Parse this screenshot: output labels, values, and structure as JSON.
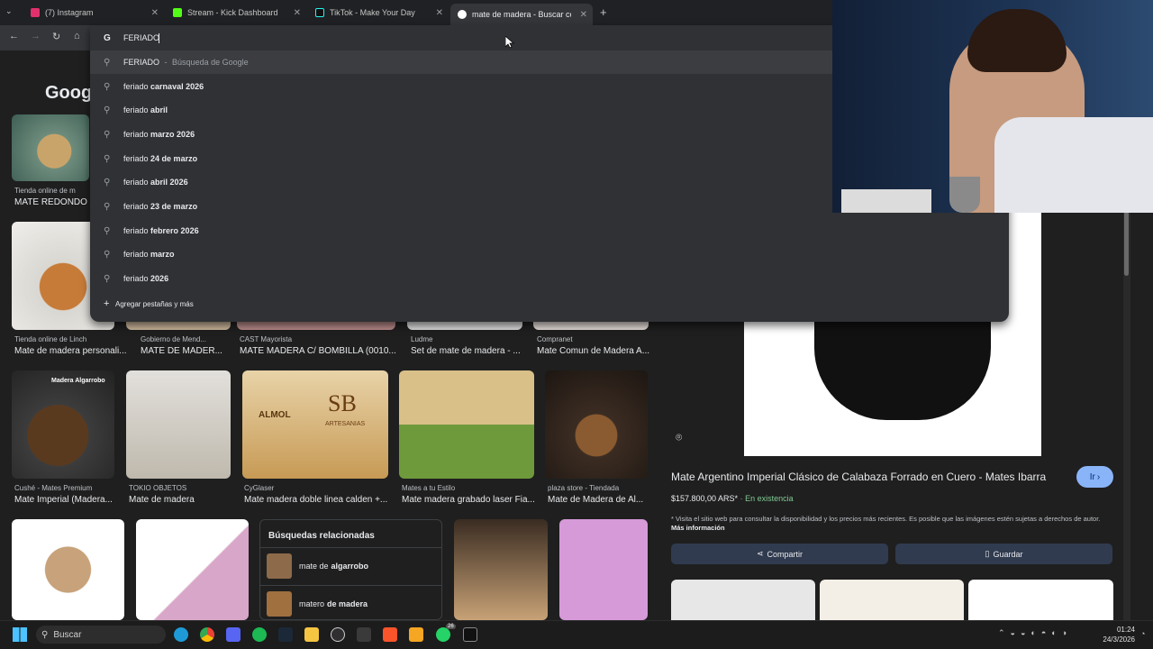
{
  "tabs": [
    {
      "title": "(7) Instagram",
      "color": "#e1306c"
    },
    {
      "title": "Stream - Kick Dashboard",
      "color": "#53fc18"
    },
    {
      "title": "TikTok - Make Your Day",
      "color": "#111111"
    },
    {
      "title": "mate de madera - Buscar con G",
      "color": "#4285f4"
    }
  ],
  "omnibox": {
    "query": "FERIADO",
    "engine_letter": "G",
    "top": {
      "term": "FERIADO",
      "sep": "-",
      "hint": "Búsqueda de Google"
    },
    "suggestions": [
      {
        "prefix": "feriado",
        "rest": "carnaval 2026"
      },
      {
        "prefix": "feriado",
        "rest": "abril"
      },
      {
        "prefix": "feriado",
        "rest": "marzo 2026"
      },
      {
        "prefix": "feriado",
        "rest": "24 de marzo"
      },
      {
        "prefix": "feriado",
        "rest": "abril 2026"
      },
      {
        "prefix": "feriado",
        "rest": "23 de marzo"
      },
      {
        "prefix": "feriado",
        "rest": "febrero 2026"
      },
      {
        "prefix": "feriado",
        "rest": "marzo"
      },
      {
        "prefix": "feriado",
        "rest": "2026"
      }
    ],
    "add_tabs": "Agregar pestañas y más"
  },
  "google_logo": "Googl",
  "left_results": {
    "r1": {
      "source": "Tienda online de m",
      "title": "MATE REDONDO"
    }
  },
  "row2": [
    {
      "source": "Tienda online de Linch",
      "title": "Mate de madera personali..."
    },
    {
      "source": "Gobierno de Mend...",
      "title": "MATE DE MADER..."
    },
    {
      "source": "CAST Mayorista",
      "title": "MATE MADERA C/ BOMBILLA (0010..."
    },
    {
      "source": "Ludme",
      "title": "Set de mate de madera - ..."
    },
    {
      "source": "Compranet",
      "title": "Mate Comun de Madera A..."
    }
  ],
  "row3": [
    {
      "source": "Cushé - Mates Premium",
      "title": "Mate Imperial (Madera..."
    },
    {
      "source": "TOKIO OBJETOS",
      "title": "Mate de madera"
    },
    {
      "source": "CyGlaser",
      "title": "Mate madera doble linea calden +..."
    },
    {
      "source": "Mates a tu Estilo",
      "title": "Mate madera grabado laser Fia..."
    },
    {
      "source": "plaza store - Tiendada",
      "title": "Mate de Madera de Al..."
    }
  ],
  "related": {
    "heading": "Búsquedas relacionadas",
    "items": [
      {
        "plain": "mate de",
        "bold": "algarrobo"
      },
      {
        "plain": "matero",
        "bold": "de madera"
      }
    ]
  },
  "image_text": {
    "algarrobo": "Madera Algarrobo",
    "sb": "SB",
    "artesanias": "ARTESANIAS",
    "almol": "ALMOL"
  },
  "panel": {
    "title": "Mate Argentino Imperial Clásico de Calabaza Forrado en Cuero - Mates Ibarra",
    "go_btn": "Ir",
    "price": "$157.800,00 ARS*",
    "dot": "·",
    "stock": "En existencia",
    "note": "* Visita el sitio web para consultar la disponibilidad y los precios más recientes. Es posible que las imágenes estén sujetas a derechos de autor.",
    "more": "Más información",
    "share": "Compartir",
    "save": "Guardar"
  },
  "taskbar": {
    "search": "Buscar",
    "time": "01:24",
    "date": "24/3/2026",
    "badge": "26"
  },
  "colors": {
    "accent": "#8ab4f8",
    "stock": "#81c995",
    "button": "#303b4f"
  }
}
